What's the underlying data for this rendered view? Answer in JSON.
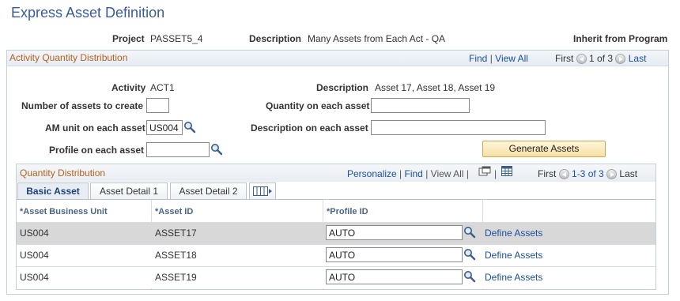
{
  "page_title": "Express Asset Definition",
  "header": {
    "project_label": "Project",
    "project_value": "PASSET5_4",
    "description_label": "Description",
    "description_value": "Many Assets from Each Act - QA",
    "inherit_label": "Inherit from Program"
  },
  "activity_section": {
    "title": "Activity Quantity Distribution",
    "find": "Find",
    "view_all": "View All",
    "first": "First",
    "counter": "1 of 3",
    "last": "Last",
    "activity_label": "Activity",
    "activity_value": "ACT1",
    "description_label": "Description",
    "description_value": "Asset 17, Asset 18, Asset 19",
    "num_assets_label": "Number of assets to create",
    "num_assets_value": "",
    "qty_each_label": "Quantity on each asset",
    "qty_each_value": "",
    "am_unit_label": "AM unit on each asset",
    "am_unit_value": "US004",
    "desc_each_label": "Description on each asset",
    "desc_each_value": "",
    "profile_label": "Profile on each asset",
    "profile_value": "",
    "generate_button": "Generate Assets"
  },
  "grid": {
    "title": "Quantity Distribution",
    "personalize": "Personalize",
    "find": "Find",
    "view_all": "View All",
    "first": "First",
    "counter": "1-3 of 3",
    "last": "Last",
    "tabs": [
      "Basic Asset",
      "Asset Detail 1",
      "Asset Detail 2"
    ],
    "columns": [
      "*Asset Business Unit",
      "*Asset ID",
      "*Profile ID"
    ],
    "rows": [
      {
        "business_unit": "US004",
        "asset_id": "ASSET17",
        "profile_id": "AUTO",
        "action": "Define Assets"
      },
      {
        "business_unit": "US004",
        "asset_id": "ASSET18",
        "profile_id": "AUTO",
        "action": "Define Assets"
      },
      {
        "business_unit": "US004",
        "asset_id": "ASSET19",
        "profile_id": "AUTO",
        "action": "Define Assets"
      }
    ]
  },
  "colors": {
    "title_blue": "#3a5b9e",
    "section_orange": "#b3611d",
    "link_blue": "#1b4f9a",
    "selected_row": "#d8d8d8"
  }
}
